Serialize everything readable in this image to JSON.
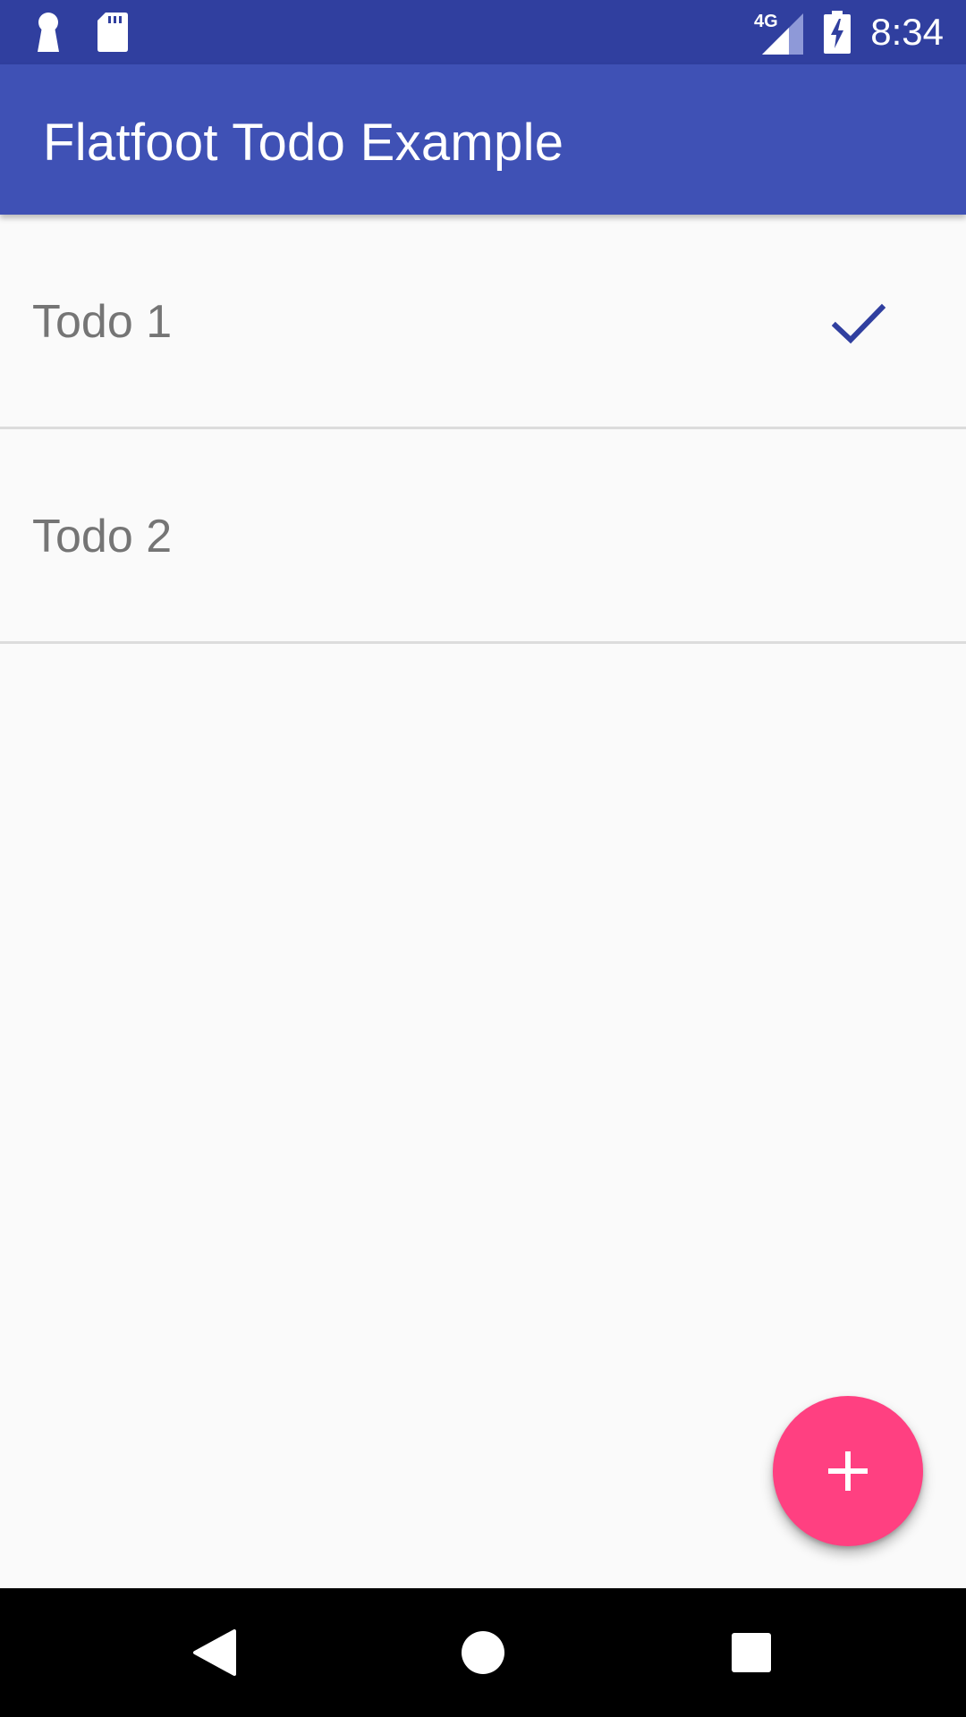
{
  "status_bar": {
    "time": "8:34",
    "network_label": "4G",
    "icons": [
      "keyhole-icon",
      "sd-card-icon",
      "signal-icon",
      "battery-charging-icon"
    ]
  },
  "app_bar": {
    "title": "Flatfoot Todo Example"
  },
  "todos": [
    {
      "label": "Todo 1",
      "done": true
    },
    {
      "label": "Todo 2",
      "done": false
    }
  ],
  "fab": {
    "icon": "plus-icon"
  },
  "nav_bar": {
    "icons": [
      "back-icon",
      "home-icon",
      "recents-icon"
    ]
  },
  "colors": {
    "status_bar": "#303f9f",
    "app_bar": "#3f51b5",
    "accent": "#ff4081",
    "check": "#303f9f",
    "text_secondary": "#757575",
    "background": "#fafafa"
  }
}
